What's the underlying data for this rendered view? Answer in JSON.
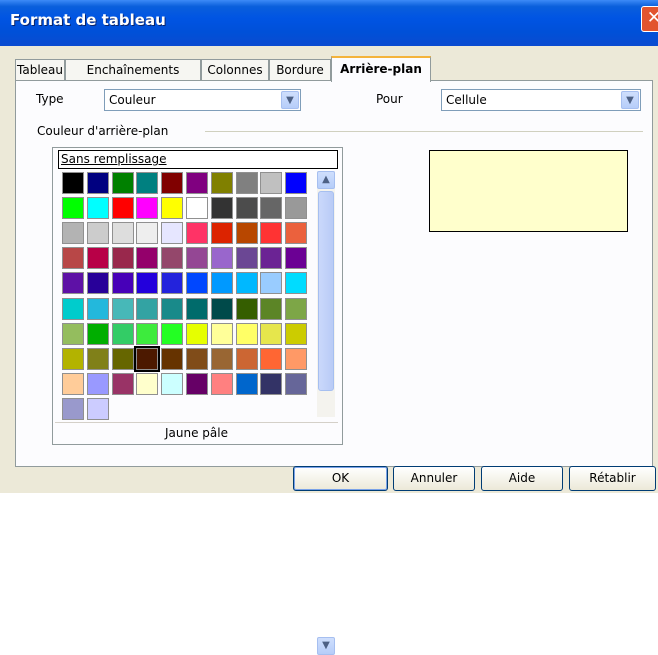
{
  "window": {
    "title": "Format de tableau",
    "close_glyph": "✕"
  },
  "tabs": [
    {
      "label": "Tableau"
    },
    {
      "label": "Enchaînements"
    },
    {
      "label": "Colonnes"
    },
    {
      "label": "Bordure"
    },
    {
      "label": "Arrière-plan",
      "active": true
    }
  ],
  "type": {
    "label": "Type",
    "value": "Couleur"
  },
  "pour": {
    "label": "Pour",
    "value": "Cellule"
  },
  "section": {
    "label": "Couleur d'arrière-plan"
  },
  "palette": {
    "none_label": "Sans remplissage",
    "selected_name": "Jaune pâle",
    "selected_index": 73,
    "colors": [
      "#000000",
      "#000080",
      "#008000",
      "#008080",
      "#800000",
      "#800080",
      "#808000",
      "#808080",
      "#c0c0c0",
      "#0000ff",
      "#00ff00",
      "#00ffff",
      "#ff0000",
      "#ff00ff",
      "#ffff00",
      "#ffffff",
      "#333333",
      "#4c4c4c",
      "#666666",
      "#999999",
      "#b3b3b3",
      "#cccccc",
      "#dddddd",
      "#eeeeee",
      "#e6e6ff",
      "#ff3366",
      "#dc2300",
      "#b84700",
      "#ff3333",
      "#eb613d",
      "#b84747",
      "#b80047",
      "#99284c",
      "#94006b",
      "#94476b",
      "#944794",
      "#9966cc",
      "#6b4794",
      "#6b2394",
      "#6b0094",
      "#5e11a6",
      "#280099",
      "#4700b8",
      "#2300dc",
      "#2323dc",
      "#0047ff",
      "#0099ff",
      "#00b8ff",
      "#99ccff",
      "#00dcff",
      "#00cccc",
      "#23b8dc",
      "#47b8b8",
      "#33a3a3",
      "#198a8a",
      "#006b6b",
      "#004a4a",
      "#355e00",
      "#5c8526",
      "#7da647",
      "#94bd5e",
      "#00ae00",
      "#33cc66",
      "#3deb3d",
      "#23ff23",
      "#e6ff00",
      "#ffff99",
      "#ffff66",
      "#e6e64c",
      "#cccc00",
      "#b3b300",
      "#808019",
      "#666600",
      "#4c1900",
      "#663300",
      "#804c19",
      "#996633",
      "#cc6633",
      "#ff6633",
      "#ff9966",
      "#ffcc99",
      "#9999ff",
      "#993366",
      "#ffffcc",
      "#ccffff",
      "#660066",
      "#ff8080",
      "#0066cc",
      "#333366",
      "#666699",
      "#9999cc",
      "#ccccff"
    ]
  },
  "preview": {
    "color": "#ffffcc"
  },
  "buttons": {
    "ok": "OK",
    "cancel": "Annuler",
    "help": "Aide",
    "reset": "Rétablir"
  }
}
